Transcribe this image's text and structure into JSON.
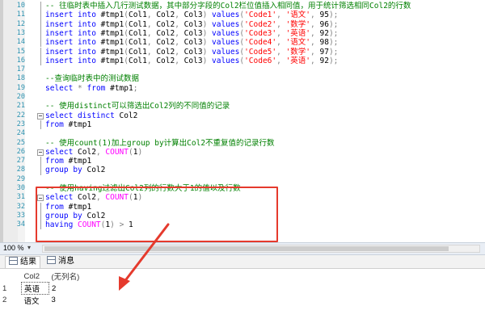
{
  "editor": {
    "lines": [
      {
        "n": "10",
        "fold": "bar",
        "tokens": [
          [
            "cm",
            "-- 往临时表中插入几行测试数据，其中部分字段的Col2栏位值插入相同值，用于统计筛选相同Col2的行数"
          ]
        ]
      },
      {
        "n": "11",
        "fold": "bar",
        "tokens": [
          [
            "kw",
            "insert into "
          ],
          [
            "tx",
            "#tmp1"
          ],
          [
            "gr",
            "("
          ],
          [
            "tx",
            "Col1"
          ],
          [
            "gr",
            ", "
          ],
          [
            "tx",
            "Col2"
          ],
          [
            "gr",
            ", "
          ],
          [
            "tx",
            "Col3"
          ],
          [
            "gr",
            ") "
          ],
          [
            "kw",
            "values"
          ],
          [
            "gr",
            "("
          ],
          [
            "str",
            "'Code1'"
          ],
          [
            "gr",
            ", "
          ],
          [
            "str",
            "'语文'"
          ],
          [
            "gr",
            ", "
          ],
          [
            "tx",
            "95"
          ],
          [
            "gr",
            ");"
          ]
        ]
      },
      {
        "n": "12",
        "fold": "bar",
        "tokens": [
          [
            "kw",
            "insert into "
          ],
          [
            "tx",
            "#tmp1"
          ],
          [
            "gr",
            "("
          ],
          [
            "tx",
            "Col1"
          ],
          [
            "gr",
            ", "
          ],
          [
            "tx",
            "Col2"
          ],
          [
            "gr",
            ", "
          ],
          [
            "tx",
            "Col3"
          ],
          [
            "gr",
            ") "
          ],
          [
            "kw",
            "values"
          ],
          [
            "gr",
            "("
          ],
          [
            "str",
            "'Code2'"
          ],
          [
            "gr",
            ", "
          ],
          [
            "str",
            "'数学'"
          ],
          [
            "gr",
            ", "
          ],
          [
            "tx",
            "96"
          ],
          [
            "gr",
            ");"
          ]
        ]
      },
      {
        "n": "13",
        "fold": "bar",
        "tokens": [
          [
            "kw",
            "insert into "
          ],
          [
            "tx",
            "#tmp1"
          ],
          [
            "gr",
            "("
          ],
          [
            "tx",
            "Col1"
          ],
          [
            "gr",
            ", "
          ],
          [
            "tx",
            "Col2"
          ],
          [
            "gr",
            ", "
          ],
          [
            "tx",
            "Col3"
          ],
          [
            "gr",
            ") "
          ],
          [
            "kw",
            "values"
          ],
          [
            "gr",
            "("
          ],
          [
            "str",
            "'Code3'"
          ],
          [
            "gr",
            ", "
          ],
          [
            "str",
            "'英语'"
          ],
          [
            "gr",
            ", "
          ],
          [
            "tx",
            "92"
          ],
          [
            "gr",
            ");"
          ]
        ]
      },
      {
        "n": "14",
        "fold": "bar",
        "tokens": [
          [
            "kw",
            "insert into "
          ],
          [
            "tx",
            "#tmp1"
          ],
          [
            "gr",
            "("
          ],
          [
            "tx",
            "Col1"
          ],
          [
            "gr",
            ", "
          ],
          [
            "tx",
            "Col2"
          ],
          [
            "gr",
            ", "
          ],
          [
            "tx",
            "Col3"
          ],
          [
            "gr",
            ") "
          ],
          [
            "kw",
            "values"
          ],
          [
            "gr",
            "("
          ],
          [
            "str",
            "'Code4'"
          ],
          [
            "gr",
            ", "
          ],
          [
            "str",
            "'语文'"
          ],
          [
            "gr",
            ", "
          ],
          [
            "tx",
            "98"
          ],
          [
            "gr",
            ");"
          ]
        ]
      },
      {
        "n": "15",
        "fold": "bar",
        "tokens": [
          [
            "kw",
            "insert into "
          ],
          [
            "tx",
            "#tmp1"
          ],
          [
            "gr",
            "("
          ],
          [
            "tx",
            "Col1"
          ],
          [
            "gr",
            ", "
          ],
          [
            "tx",
            "Col2"
          ],
          [
            "gr",
            ", "
          ],
          [
            "tx",
            "Col3"
          ],
          [
            "gr",
            ") "
          ],
          [
            "kw",
            "values"
          ],
          [
            "gr",
            "("
          ],
          [
            "str",
            "'Code5'"
          ],
          [
            "gr",
            ", "
          ],
          [
            "str",
            "'数学'"
          ],
          [
            "gr",
            ", "
          ],
          [
            "tx",
            "97"
          ],
          [
            "gr",
            ");"
          ]
        ]
      },
      {
        "n": "16",
        "fold": "bar",
        "tokens": [
          [
            "kw",
            "insert into "
          ],
          [
            "tx",
            "#tmp1"
          ],
          [
            "gr",
            "("
          ],
          [
            "tx",
            "Col1"
          ],
          [
            "gr",
            ", "
          ],
          [
            "tx",
            "Col2"
          ],
          [
            "gr",
            ", "
          ],
          [
            "tx",
            "Col3"
          ],
          [
            "gr",
            ") "
          ],
          [
            "kw",
            "values"
          ],
          [
            "gr",
            "("
          ],
          [
            "str",
            "'Code6'"
          ],
          [
            "gr",
            ", "
          ],
          [
            "str",
            "'英语'"
          ],
          [
            "gr",
            ", "
          ],
          [
            "tx",
            "92"
          ],
          [
            "gr",
            ");"
          ]
        ]
      },
      {
        "n": "17",
        "fold": "none",
        "tokens": []
      },
      {
        "n": "18",
        "fold": "none",
        "tokens": [
          [
            "cm",
            "--查询临时表中的测试数据"
          ]
        ]
      },
      {
        "n": "19",
        "fold": "none",
        "tokens": [
          [
            "kw",
            "select "
          ],
          [
            "gr",
            "* "
          ],
          [
            "kw",
            "from "
          ],
          [
            "tx",
            "#tmp1"
          ],
          [
            "gr",
            ";"
          ]
        ]
      },
      {
        "n": "20",
        "fold": "none",
        "tokens": []
      },
      {
        "n": "21",
        "fold": "none",
        "tokens": [
          [
            "cm",
            "-- 使用distinct可以筛选出Col2列的不同值的记录"
          ]
        ]
      },
      {
        "n": "22",
        "fold": "box",
        "tokens": [
          [
            "kw",
            "select distinct "
          ],
          [
            "tx",
            "Col2"
          ]
        ]
      },
      {
        "n": "23",
        "fold": "bar",
        "tokens": [
          [
            "kw",
            "from "
          ],
          [
            "tx",
            "#tmp1"
          ]
        ]
      },
      {
        "n": "24",
        "fold": "none",
        "tokens": []
      },
      {
        "n": "25",
        "fold": "none",
        "tokens": [
          [
            "cm",
            "-- 使用count(1)加上group by计算出Col2不重复值的记录行数"
          ]
        ]
      },
      {
        "n": "26",
        "fold": "box",
        "tokens": [
          [
            "kw",
            "select "
          ],
          [
            "tx",
            "Col2"
          ],
          [
            "gr",
            ", "
          ],
          [
            "fn",
            "COUNT"
          ],
          [
            "gr",
            "("
          ],
          [
            "tx",
            "1"
          ],
          [
            "gr",
            ")"
          ]
        ]
      },
      {
        "n": "27",
        "fold": "bar",
        "tokens": [
          [
            "kw",
            "from "
          ],
          [
            "tx",
            "#tmp1"
          ]
        ]
      },
      {
        "n": "28",
        "fold": "bar",
        "tokens": [
          [
            "kw",
            "group by "
          ],
          [
            "tx",
            "Col2"
          ]
        ]
      },
      {
        "n": "29",
        "fold": "none",
        "tokens": []
      },
      {
        "n": "30",
        "fold": "none",
        "tokens": [
          [
            "cm",
            "-- 使用having过滤出Col2列的行数大于1的值以及行数"
          ]
        ]
      },
      {
        "n": "31",
        "fold": "box",
        "tokens": [
          [
            "kw",
            "select "
          ],
          [
            "tx",
            "Col2"
          ],
          [
            "gr",
            ", "
          ],
          [
            "fn",
            "COUNT"
          ],
          [
            "gr",
            "("
          ],
          [
            "tx",
            "1"
          ],
          [
            "gr",
            ")"
          ]
        ]
      },
      {
        "n": "32",
        "fold": "bar",
        "tokens": [
          [
            "kw",
            "from "
          ],
          [
            "tx",
            "#tmp1"
          ]
        ]
      },
      {
        "n": "33",
        "fold": "bar",
        "tokens": [
          [
            "kw",
            "group by "
          ],
          [
            "tx",
            "Col2"
          ]
        ]
      },
      {
        "n": "34",
        "fold": "bar",
        "tokens": [
          [
            "kw",
            "having "
          ],
          [
            "fn",
            "COUNT"
          ],
          [
            "gr",
            "("
          ],
          [
            "tx",
            "1"
          ],
          [
            "gr",
            ") > "
          ],
          [
            "tx",
            "1"
          ]
        ]
      }
    ]
  },
  "zoom": {
    "value": "100 %",
    "dropdown": "▾"
  },
  "tabs": [
    {
      "label": "结果"
    },
    {
      "label": "消息"
    }
  ],
  "results": {
    "columns": [
      "Col2",
      "(无列名)"
    ],
    "rows": [
      {
        "num": "1",
        "cells": [
          "英语",
          "2"
        ]
      },
      {
        "num": "2",
        "cells": [
          "语文",
          "3"
        ]
      }
    ]
  },
  "colors": {
    "highlight_box": "#e53a2d",
    "arrow": "#e53a2d",
    "keyword": "#0000ff",
    "comment": "#008000",
    "string": "#ff0000",
    "function": "#ff00ff"
  }
}
